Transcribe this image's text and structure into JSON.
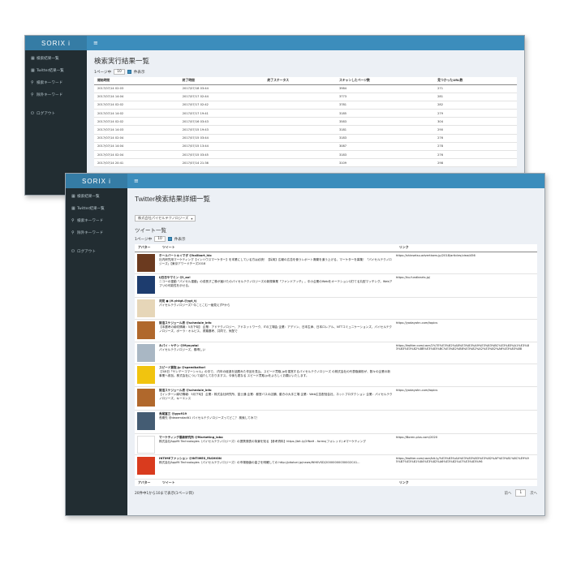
{
  "app": {
    "brand": "SORIX i",
    "menu_icon": "hamburger-icon"
  },
  "sidebar": {
    "items": [
      {
        "label": "検索結果一覧",
        "icon": "grid-icon"
      },
      {
        "label": "Twitter結果一覧",
        "icon": "grid-icon"
      },
      {
        "label": "検索キーワード",
        "icon": "search-icon"
      },
      {
        "label": "除外キーワード",
        "icon": "search-icon"
      },
      {
        "label": "ログアウト",
        "icon": "logout-icon"
      }
    ]
  },
  "window1": {
    "title": "検索実行結果一覧",
    "per_page": {
      "prefix": "1ページ中",
      "value": "10",
      "suffix": "件表示"
    },
    "columns": [
      "開始時間",
      "終了時間",
      "終了ステータス",
      "スキャンしたページ数",
      "見つかったURL数"
    ],
    "rows": [
      [
        "2017/07/14 02:03",
        "2017/07/18 03:44",
        "",
        "3984",
        "271"
      ],
      [
        "2017/07/14 14:04",
        "2017/07/17 02:44",
        "",
        "3773",
        "281"
      ],
      [
        "2017/07/14 02:02",
        "2017/07/17 02:42",
        "",
        "3781",
        "282"
      ],
      [
        "2017/07/14 14:02",
        "2017/07/17 19:41",
        "",
        "3185",
        "279"
      ],
      [
        "2017/07/14 02:02",
        "2017/07/16 03:43",
        "",
        "3583",
        "304"
      ],
      [
        "2017/07/14 14:03",
        "2017/07/15 19:43",
        "",
        "3181",
        "290"
      ],
      [
        "2017/07/14 02:04",
        "2017/07/15 03:44",
        "",
        "3183",
        "276"
      ],
      [
        "2017/07/14 14:04",
        "2017/07/15 13:44",
        "",
        "3087",
        "278"
      ],
      [
        "2017/07/14 02:04",
        "2017/07/15 03:45",
        "",
        "3183",
        "276"
      ],
      [
        "2017/07/14 20:41",
        "2017/07/14 21:36",
        "",
        "3109",
        "298"
      ]
    ]
  },
  "window2": {
    "title": "Twitter検索結果詳細一覧",
    "dropdown": "株式会社パイセルテクノロジーズ",
    "subtitle": "ツイート一覧",
    "per_page": {
      "prefix": "1ページ中",
      "value": "10",
      "suffix": "件表示"
    },
    "columns": [
      "アバター",
      "ツイート",
      "リンク"
    ],
    "tweets": [
      {
        "name": "ホールバートキイマダ @hallbart_hlo",
        "text": "社内研究用マーケティング【インハウスマーケター】を本業にしている方は必読！【採用】広報の広告を使うレポート廃棄を道う上げる、マーケターを募集！「パイセルテクノロジーズ」【東京アワードチーズ2018",
        "link": "https://shinsetsu.advertisers.jp/2018/articles/view/456",
        "avatar": "#6b3a1f"
      },
      {
        "name": "IJ日日やマミン @I_ao!",
        "text": "ニコーの運動「パイセル運動」の成長すご株が届けたのパイセルテクノロジーズの新規事業「ファンドアッチ」。中小企業のWebをオーテションQ打てる丸型マッチング。Webアプリの可能性を示せる。",
        "link": "https://ku.fundlearts.jp/",
        "avatar": "#1d3c6e"
      },
      {
        "name": "河見 ● (H.yhtgt.@ygt_t)",
        "text": "パイセルテクノロジーズ? 今ことこむ一緒見えずPから",
        "link": "",
        "avatar": "#e6d6b8"
      },
      {
        "name": "就活スケジュール表 @schedule_info",
        "text": "【本選考の締切情報：5月下旬】 企業：アドテクノロジー、アドネットワーク、ITの工場会 企業：アデソン、日本生命、日本ロレアル、NTTコミュニケーションズ、パイセルテクノロジーズ、ポーラ・オルビス、書類選考、共同で、気配で",
        "link": "https://yodayahn.com/topics",
        "avatar": "#b0682c"
      },
      {
        "name": "みパイ・ヤテン @Myoyotai",
        "text": "パイセルテクノロジーズ、素晴しい",
        "link": "https://twitter.com/user/2%7E%E3%82%A8%E3%83%A9%E3%83%BC%E3%83%A1%E3%83%83%E3%82%BB%E3%83%BC%E3%82%B8%E3%82%A2%E3%82%A6%E3%83%88",
        "avatar": "#a9b7c4"
      },
      {
        "name": "スピード買取.jp @speedkaitori",
        "text": "【3/8日「サンデーコマーシャル」の中で、 内年の経過を話題みた作品を見込。スピード買取.jpを運営するパイセルテクノロジーズ の株式会社の代表取締役が、数々の企業の新事業へ参加。株式会社について紹介しておりますス。今後も更なる スピード買取.jpをよろしくお願いいたします。",
        "link": "",
        "avatar": "#f1c40f"
      },
      {
        "name": "就活スケジュール表 @schedule_info",
        "text": "【インターン締切情報：5月下旬】 企業：株式会社研究所、富士通 企業：都営バスの店舗、動きの大手工場 企業：Web広告配信会社、ネットプロダクション 企業：パイセルテクノロジーズ、キーエンス",
        "link": "https://yodayahn.com/topics",
        "avatar": "#b0682c"
      },
      {
        "name": "長尾富三 @gyo919",
        "text": "長期先 @deaemdadlt1 パイセルテクノロジーズってどこ？ 検索してみて！",
        "link": "",
        "avatar": "#445c73"
      },
      {
        "name": "マーケティング最新研究所 @Marketing_labo",
        "text": "株式会社AppMi Technologies（パイセルテクノロジーズ）の提携発表の背景を知る【参考資料】https://bit.ly/2fNaH - forms(フォレッド) #マーケティング",
        "link": "https://Boren.plus.com/2020",
        "avatar": "#ffffff"
      },
      {
        "name": "INTIMEファッション @INTIMES_FASHION",
        "text": "株式会社AppMi Technologies（パイセルテクノロジーズ）の市場価値の高さを明確しての http://pitolvei.jp/news/WH0VSD/20000000030002C41...",
        "link": "https://twitter.com/user/bit.ly/%E3%83%AA%E3%83%B3%E3%82%AF%E3%81%8C%E9%95%B7%E3%81%84%E3%82%A6%E3%82%A7%E3%83%96",
        "avatar": "#d93b1e"
      }
    ],
    "footer_columns": [
      "アバター",
      "ツイート",
      "リンク"
    ],
    "info": "20件中1から10まで表示(1ページ目)",
    "pager": {
      "prev": "前へ",
      "current": "1",
      "next": "次へ"
    }
  }
}
